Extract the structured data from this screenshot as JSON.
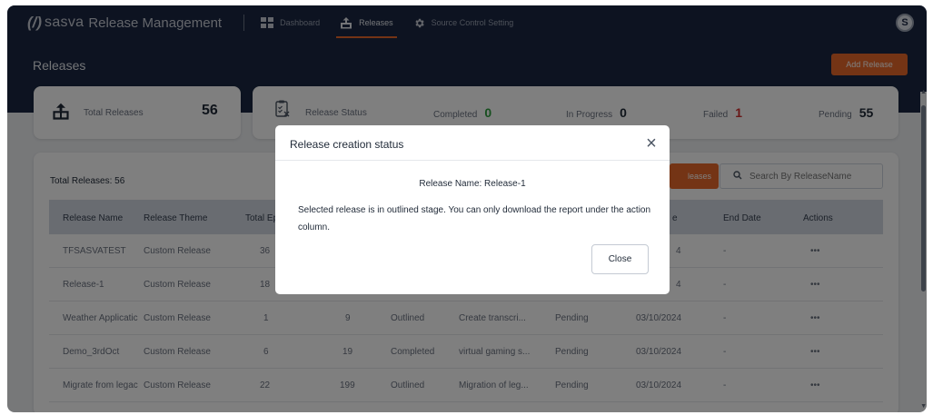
{
  "header": {
    "brand_logo": "(/)",
    "brand_name": "sasva",
    "brand_sub": "Release Management",
    "nav": [
      {
        "label": "Dashboard",
        "icon": "dashboard-icon"
      },
      {
        "label": "Releases",
        "icon": "releases-icon",
        "active": true
      },
      {
        "label": "Source Control Setting",
        "icon": "gear-icon"
      }
    ],
    "avatar_initial": "S"
  },
  "page": {
    "title": "Releases",
    "add_button": "Add Release"
  },
  "summary": {
    "total_label": "Total Releases",
    "total_value": "56",
    "status_label": "Release Status",
    "stats": [
      {
        "label": "Completed",
        "value": "0",
        "color": "#2e9e3e"
      },
      {
        "label": "In Progress",
        "value": "0",
        "color": "#1f2937"
      },
      {
        "label": "Failed",
        "value": "1",
        "color": "#d32f2f"
      },
      {
        "label": "Pending",
        "value": "55",
        "color": "#1f2937"
      }
    ]
  },
  "table": {
    "title": "Total Releases: 56",
    "filter_button": "leases",
    "search_placeholder": "Search By ReleaseName",
    "columns": [
      "Release Name",
      "Release Theme",
      "Total Epi",
      "",
      "",
      "",
      "",
      "e",
      "End Date",
      "Actions"
    ],
    "rows": [
      [
        "TFSASVATEST",
        "Custom Release",
        "36",
        "",
        "",
        "",
        "",
        "4",
        "-",
        "•••"
      ],
      [
        "Release-1",
        "Custom Release",
        "18",
        "",
        "",
        "",
        "",
        "4",
        "-",
        "•••"
      ],
      [
        "Weather Applicatic",
        "Custom Release",
        "1",
        "9",
        "Outlined",
        "Create transcri...",
        "Pending",
        "03/10/2024",
        "-",
        "•••"
      ],
      [
        "Demo_3rdOct",
        "Custom Release",
        "6",
        "19",
        "Completed",
        "virtual gaming s...",
        "Pending",
        "03/10/2024",
        "-",
        "•••"
      ],
      [
        "Migrate from legac",
        "Custom Release",
        "22",
        "199",
        "Outlined",
        "Migration of leg...",
        "Pending",
        "03/10/2024",
        "-",
        "•••"
      ]
    ]
  },
  "modal": {
    "title": "Release creation status",
    "close_x": "×",
    "release_name": "Release Name: Release-1",
    "message": "Selected release is in outlined stage. You can only download the report under the action column.",
    "close_button": "Close"
  },
  "colors": {
    "nav_bg": "#1a2742",
    "accent": "#e8692a",
    "table_header_bg": "#d2d9e3"
  }
}
